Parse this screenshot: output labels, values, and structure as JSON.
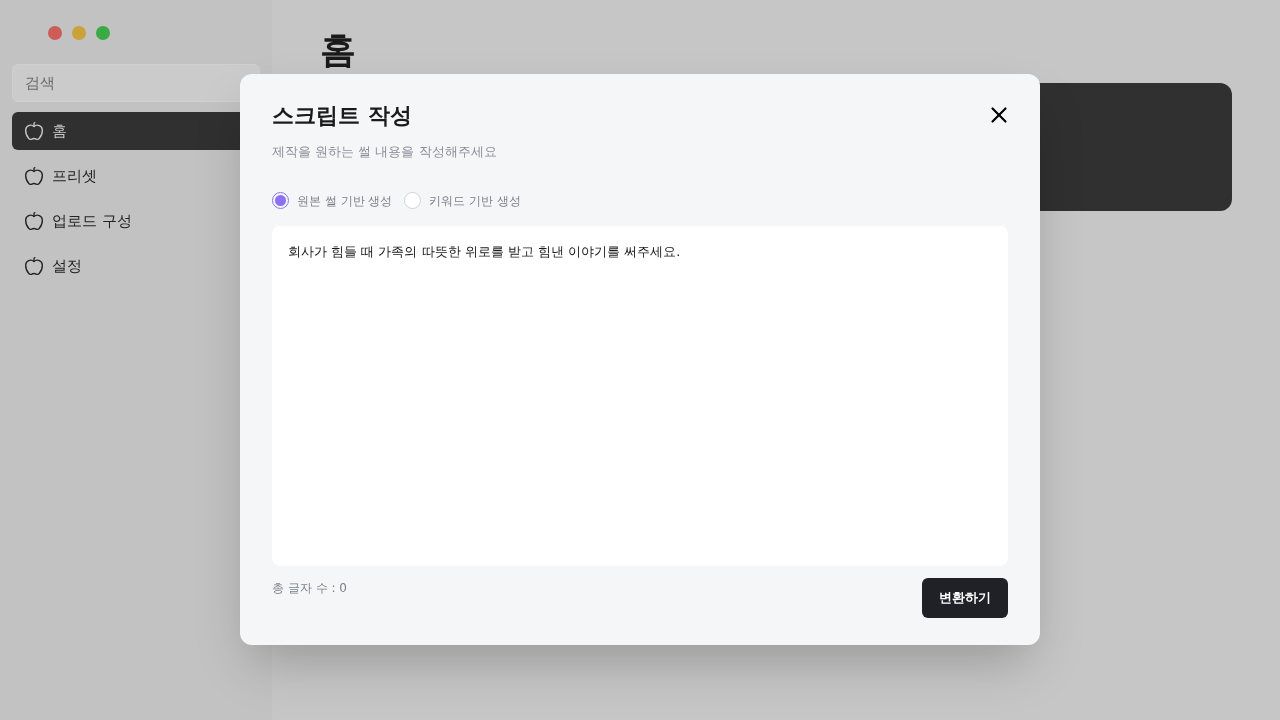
{
  "sidebar": {
    "search": {
      "placeholder": "검색"
    },
    "items": [
      {
        "label": "홈",
        "selected": true
      },
      {
        "label": "프리셋",
        "selected": false
      },
      {
        "label": "업로드 구성",
        "selected": false
      },
      {
        "label": "설정",
        "selected": false
      }
    ]
  },
  "page": {
    "title": "홈"
  },
  "dialog": {
    "title": "스크립트 작성",
    "subtitle": "제작을 원하는 썰 내용을 작성해주세요",
    "options": [
      {
        "label": "원본 썰 기반 생성",
        "selected": true
      },
      {
        "label": "키워드 기반 생성",
        "selected": false
      }
    ],
    "text": "회사가 힘들 때 가족의 따뜻한 위로를 받고 힘낸 이야기를 써주세요.",
    "count": "총 글자 수 : 0",
    "button": "변환하기"
  }
}
